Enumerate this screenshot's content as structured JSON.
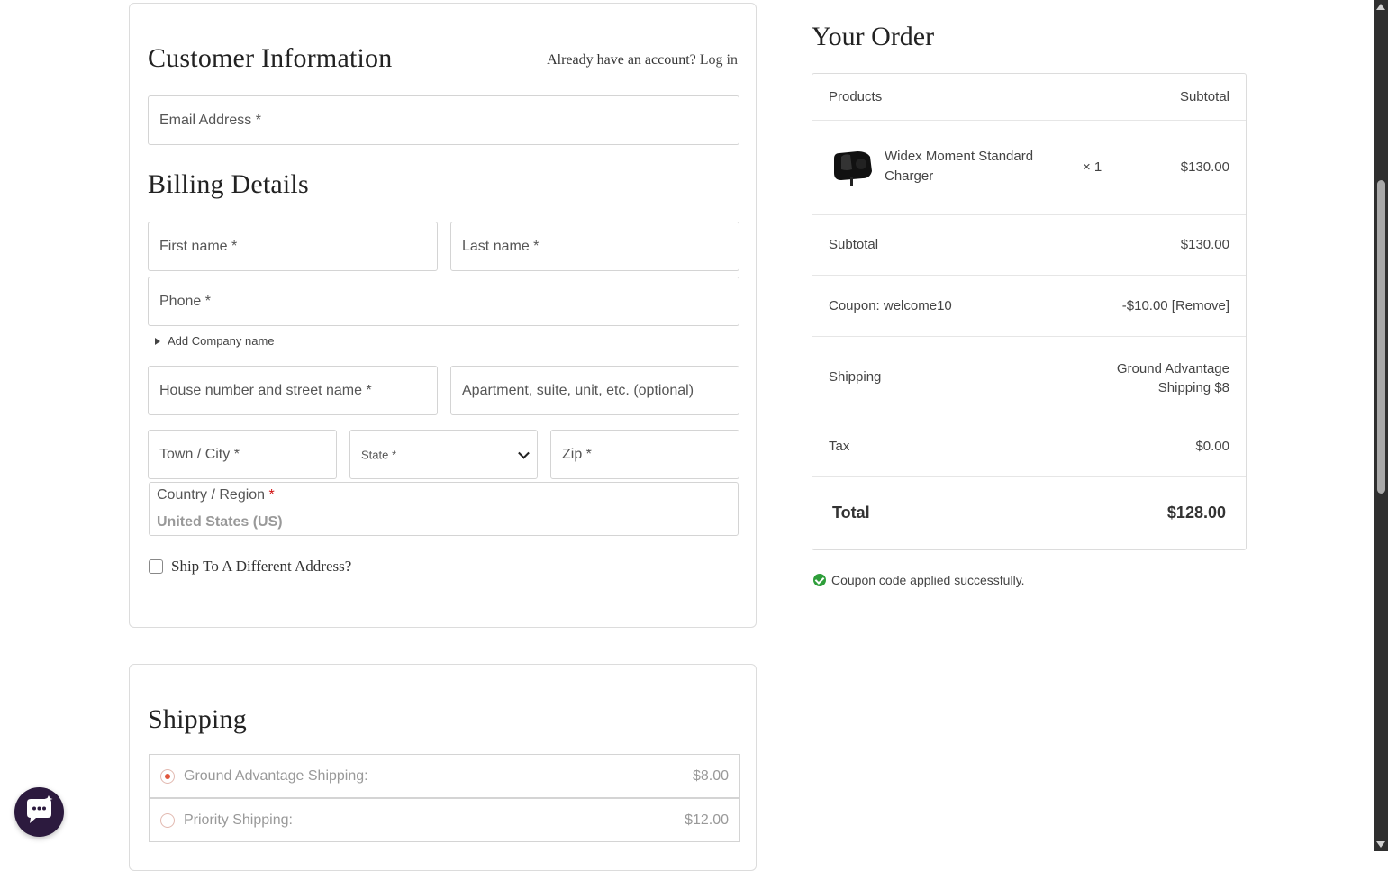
{
  "customer": {
    "title": "Customer Information",
    "account_prompt": "Already have an account?",
    "login_link": "Log in",
    "email_placeholder": "Email Address *"
  },
  "billing": {
    "title": "Billing Details",
    "first_name": "First name *",
    "last_name": "Last name *",
    "phone": "Phone *",
    "add_company": "Add Company name",
    "street": "House number and street name *",
    "apartment": "Apartment, suite, unit, etc. (optional)",
    "city": "Town / City *",
    "state": "State *",
    "zip": "Zip *",
    "country_label": "Country / Region",
    "country_required": "*",
    "country_value": "United States (US)",
    "ship_different": "Ship To A Different Address?"
  },
  "shipping": {
    "title": "Shipping",
    "options": [
      {
        "label": "Ground Advantage Shipping:",
        "price": "$8.00",
        "selected": true
      },
      {
        "label": "Priority Shipping:",
        "price": "$12.00",
        "selected": false
      }
    ]
  },
  "order": {
    "title": "Your Order",
    "col_products": "Products",
    "col_subtotal": "Subtotal",
    "product": {
      "name": "Widex Moment Standard Charger",
      "qty": "× 1",
      "price": "$130.00"
    },
    "subtotal_label": "Subtotal",
    "subtotal_value": "$130.00",
    "coupon_label": "Coupon: welcome10",
    "coupon_value": "-$10.00 [Remove]",
    "shipping_label": "Shipping",
    "shipping_value_line1": "Ground Advantage",
    "shipping_value_line2": "Shipping $8",
    "tax_label": "Tax",
    "tax_value": "$0.00",
    "total_label": "Total",
    "total_value": "$128.00"
  },
  "notice": {
    "coupon_success": "Coupon code applied successfully."
  },
  "colors": {
    "accent_radio": "#e0563c",
    "success": "#2e9e3a",
    "required": "#d01010",
    "chat_bg": "#2c1a3e"
  }
}
